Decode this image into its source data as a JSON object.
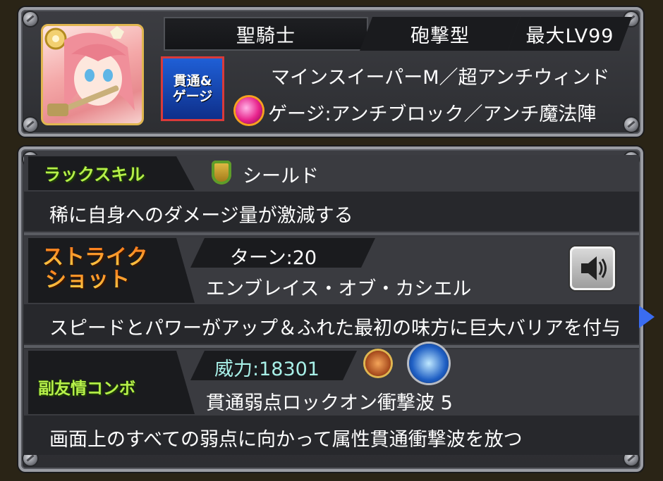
{
  "header": {
    "race": "聖騎士",
    "battle_type": "砲撃型",
    "max_level": "最大LV99",
    "ability_badge": "貫通&ゲージ",
    "ability_main": "マインスイーパーM／超アンチウィンド",
    "gauge_ability": "ゲージ:アンチブロック／アンチ魔法陣"
  },
  "luck_skill": {
    "label": "ラックスキル",
    "name": "シールド",
    "description": "稀に自身へのダメージ量が激減する"
  },
  "strike_shot": {
    "label_line1": "ストライク",
    "label_line2": "ショット",
    "turns": "ターン:20",
    "name": "エンブレイス・オブ・カシエル",
    "description": "スピードとパワーがアップ＆ふれた最初の味方に巨大バリアを付与",
    "sound_icon": "speaker-icon"
  },
  "sub_friendship": {
    "label": "副友情コンボ",
    "power": "威力:18301",
    "name": "貫通弱点ロックオン衝撃波 5",
    "description": "画面上のすべての弱点に向かって属性貫通衝撃波を放つ"
  },
  "colors": {
    "panel_border": "#9a9ca3",
    "green_label": "#b6f04a",
    "power_text": "#a8f0e8",
    "next_arrow": "#3a6cf0"
  }
}
